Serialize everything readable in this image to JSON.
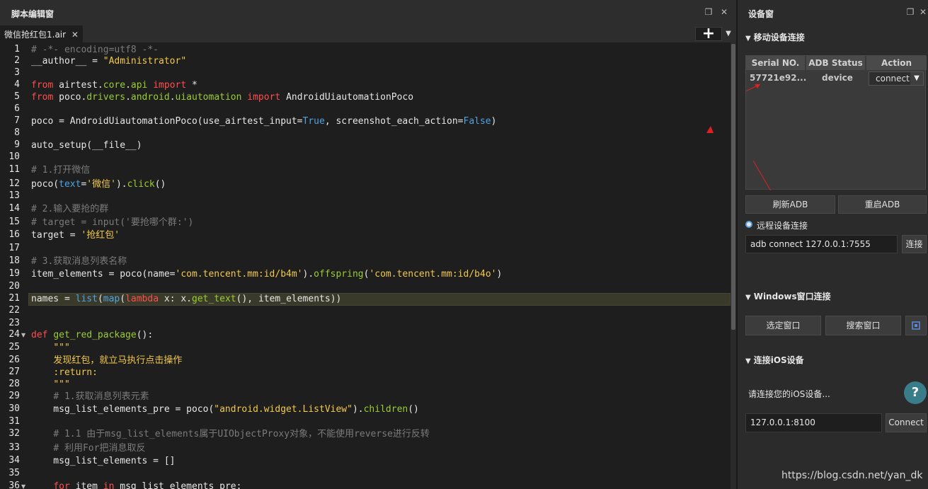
{
  "editor": {
    "title": "脚本编辑窗",
    "restore_icon": "❐",
    "close_icon": "✕",
    "tab": {
      "label": "微信抢红包1.air",
      "close": "✕"
    },
    "add_label": "+",
    "dropdown_icon": "▼"
  },
  "code_lines": [
    {
      "n": "1",
      "html": "<span class='c-com'># -*- encoding=utf8 -*-</span>"
    },
    {
      "n": "2",
      "html": "__author__ = <span class='c-str'>\"Administrator\"</span>"
    },
    {
      "n": "3",
      "html": ""
    },
    {
      "n": "4",
      "html": "<span class='c-kw'>from</span> airtest.<span class='c-mod'>core</span>.<span class='c-mod'>api</span> <span class='c-kw'>import</span> *"
    },
    {
      "n": "5",
      "html": "<span class='c-kw'>from</span> poco.<span class='c-mod'>drivers</span>.<span class='c-mod'>android</span>.<span class='c-mod'>uiautomation</span> <span class='c-kw'>import</span> AndroidUiautomationPoco"
    },
    {
      "n": "6",
      "html": ""
    },
    {
      "n": "7",
      "html": "poco = AndroidUiautomationPoco(use_airtest_input=<span class='c-bool'>True</span>, screenshot_each_action=<span class='c-bool'>False</span>)"
    },
    {
      "n": "8",
      "html": ""
    },
    {
      "n": "9",
      "html": "auto_setup(__file__)"
    },
    {
      "n": "10",
      "html": ""
    },
    {
      "n": "11",
      "html": "<span class='c-com'># 1.打开微信</span>"
    },
    {
      "n": "12",
      "html": "poco(<span class='c-param'>text</span>=<span class='c-str'>'微信'</span>).<span class='c-fn'>click</span>()"
    },
    {
      "n": "13",
      "html": ""
    },
    {
      "n": "14",
      "html": "<span class='c-com'># 2.输入要抢的群</span>"
    },
    {
      "n": "15",
      "html": "<span class='c-com'># target = input('要抢哪个群:')</span>"
    },
    {
      "n": "16",
      "html": "target = <span class='c-str'>'抢红包'</span>"
    },
    {
      "n": "17",
      "html": ""
    },
    {
      "n": "18",
      "html": "<span class='c-com'># 3.获取消息列表名称</span>"
    },
    {
      "n": "19",
      "html": "item_elements = poco(name=<span class='c-str'>'com.tencent.mm:id/b4m'</span>).<span class='c-fn'>offspring</span>(<span class='c-str'>'com.tencent.mm:id/b4o'</span>)"
    },
    {
      "n": "20",
      "html": ""
    },
    {
      "n": "21",
      "html": "names = <span class='c-builtin'>list</span>(<span class='c-builtin'>map</span>(<span class='c-kw'>lambda</span> x: x.<span class='c-fn'>get_text</span>(), item_elements))"
    },
    {
      "n": "22",
      "html": ""
    },
    {
      "n": "23",
      "html": ""
    },
    {
      "n": "24",
      "html": "<span class='c-kw'>def</span> <span class='c-fn'>get_red_package</span>():"
    },
    {
      "n": "25",
      "html": "    <span class='c-doc'>\"\"\"</span>"
    },
    {
      "n": "26",
      "html": "    <span class='c-doc'>发现红包，就立马执行点击操作</span>"
    },
    {
      "n": "27",
      "html": "    <span class='c-doc'>:return:</span>"
    },
    {
      "n": "28",
      "html": "    <span class='c-doc'>\"\"\"</span>"
    },
    {
      "n": "29",
      "html": "    <span class='c-com'># 1.获取消息列表元素</span>"
    },
    {
      "n": "30",
      "html": "    msg_list_elements_pre = poco(<span class='c-str'>\"android.widget.ListView\"</span>).<span class='c-fn'>children</span>()"
    },
    {
      "n": "31",
      "html": ""
    },
    {
      "n": "32",
      "html": "    <span class='c-com'># 1.1 由于msg_list_elements属于UIObjectProxy对象，不能使用reverse进行反转</span>"
    },
    {
      "n": "33",
      "html": "    <span class='c-com'># 利用For把消息取反</span>"
    },
    {
      "n": "34",
      "html": "    msg_list_elements = []"
    },
    {
      "n": "35",
      "html": ""
    },
    {
      "n": "36",
      "html": "    <span class='c-kw'>for</span> item <span class='c-kw'>in</span> msg_list_elements_pre:"
    }
  ],
  "device": {
    "title": "设备窗",
    "mobile_section": "移动设备连接",
    "table_headers": [
      "Serial NO.",
      "ADB Status",
      "Action"
    ],
    "row": {
      "serial": "57721e92...",
      "status": "device",
      "action": "connect"
    },
    "refresh_adb": "刷新ADB",
    "restart_adb": "重启ADB",
    "remote_section": "远程设备连接",
    "remote_input_value": "adb connect 127.0.0.1:7555",
    "remote_connect": "连接",
    "windows_section": "Windows窗口连接",
    "select_window": "选定窗口",
    "search_window": "搜索窗口",
    "ios_section": "连接iOS设备",
    "ios_prompt": "请连接您的iOS设备...",
    "ios_input_value": "127.0.0.1:8100",
    "ios_connect": "Connect",
    "help": "?",
    "section_tri": "▼"
  },
  "watermark": "https://blog.csdn.net/yan_dk",
  "colors": {
    "accent_red": "#e02020",
    "help_teal": "#3a7d8a"
  }
}
